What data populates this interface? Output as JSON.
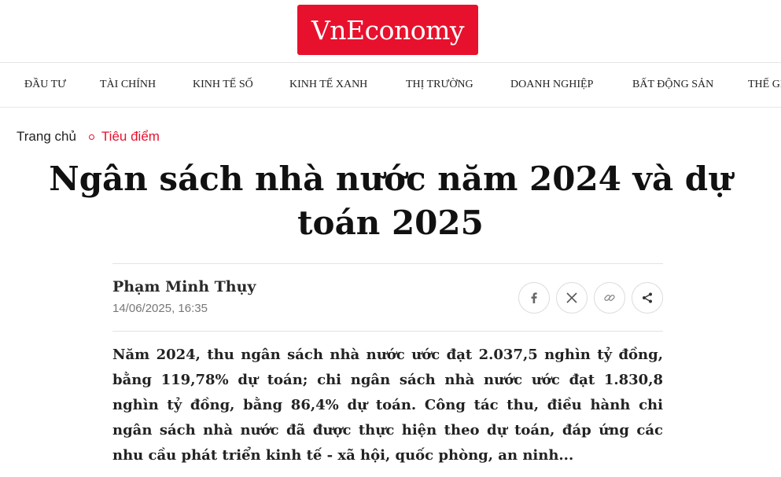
{
  "brand": {
    "logo_text": "VnEconomy",
    "accent_color": "#e8112d"
  },
  "nav": {
    "items": [
      "ĐẦU TƯ",
      "TÀI CHÍNH",
      "KINH TẾ SỐ",
      "KINH TẾ XANH",
      "THỊ TRƯỜNG",
      "DOANH NGHIỆP",
      "BẤT ĐỘNG SẢN",
      "THẾ GIỚI"
    ]
  },
  "breadcrumb": {
    "home": "Trang chủ",
    "current": "Tiêu điểm"
  },
  "article": {
    "title": "Ngân sách nhà nước năm 2024 và dự toán 2025",
    "author": "Phạm Minh Thụy",
    "date": "14/06/2025, 16:35",
    "lead": "Năm 2024, thu ngân sách nhà nước ước đạt 2.037,5 nghìn tỷ đồng, bằng 119,78% dự toán; chi ngân sách nhà nước ước đạt 1.830,8 nghìn tỷ đồng, bằng 86,4% dự toán. Công tác thu, điều hành chi ngân sách nhà nước đã được thực hiện theo dự toán, đáp ứng các nhu cầu phát triển kinh tế - xã hội, quốc phòng, an ninh..."
  },
  "share": {
    "icons": [
      "facebook-icon",
      "x-icon",
      "link-icon",
      "share-icon"
    ]
  }
}
